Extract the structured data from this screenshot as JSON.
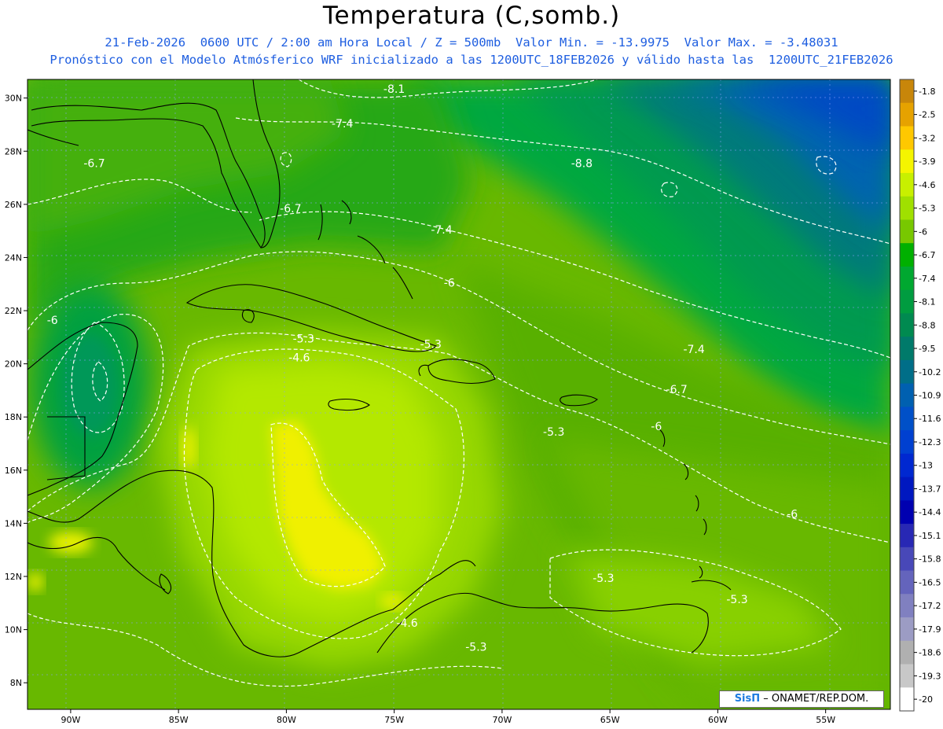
{
  "header": {
    "title": "Temperatura (C,somb.)",
    "line1": "21-Feb-2026  0600 UTC / 2:00 am Hora Local / Z = 500mb  Valor Min. = -13.9975  Valor Max. = -3.48031",
    "line2": "Pronóstico con el Modelo Atmósferico WRF inicializado a las 1200UTC_18FEB2026 y válido hasta las  1200UTC_21FEB2026"
  },
  "map": {
    "lon_range": [
      -92,
      -52
    ],
    "lat_range": [
      7,
      30.7
    ],
    "lon_ticks": [
      "90W",
      "85W",
      "80W",
      "75W",
      "70W",
      "65W",
      "60W",
      "55W"
    ],
    "lat_ticks": [
      "30N",
      "28N",
      "26N",
      "24N",
      "22N",
      "20N",
      "18N",
      "16N",
      "14N",
      "12N",
      "10N",
      "8N"
    ],
    "contour_labels": [
      {
        "text": "-8.1",
        "lon": -75.5,
        "lat": 30.2
      },
      {
        "text": "-7.4",
        "lon": -77.9,
        "lat": 28.9
      },
      {
        "text": "-6.7",
        "lon": -89.4,
        "lat": 27.4
      },
      {
        "text": "-8.8",
        "lon": -66.8,
        "lat": 27.4
      },
      {
        "text": "-6.7",
        "lon": -80.3,
        "lat": 25.7
      },
      {
        "text": "-7.4",
        "lon": -73.3,
        "lat": 24.9
      },
      {
        "text": "-6",
        "lon": -72.7,
        "lat": 22.9
      },
      {
        "text": "-6",
        "lon": -91.1,
        "lat": 21.5
      },
      {
        "text": "-5.3",
        "lon": -79.7,
        "lat": 20.8
      },
      {
        "text": "-5.3",
        "lon": -73.8,
        "lat": 20.6
      },
      {
        "text": "-4.6",
        "lon": -79.9,
        "lat": 20.1
      },
      {
        "text": "-7.4",
        "lon": -61.6,
        "lat": 20.4
      },
      {
        "text": "-6.7",
        "lon": -62.4,
        "lat": 18.9
      },
      {
        "text": "-5.3",
        "lon": -68.1,
        "lat": 17.3
      },
      {
        "text": "-6",
        "lon": -63.1,
        "lat": 17.5
      },
      {
        "text": "-6",
        "lon": -56.8,
        "lat": 14.2
      },
      {
        "text": "-5.3",
        "lon": -65.8,
        "lat": 11.8
      },
      {
        "text": "-5.3",
        "lon": -59.6,
        "lat": 11.0
      },
      {
        "text": "-4.6",
        "lon": -74.9,
        "lat": 10.1
      },
      {
        "text": "-5.3",
        "lon": -71.7,
        "lat": 9.2
      }
    ]
  },
  "colorbar": {
    "labels": [
      "-1.8",
      "-2.5",
      "-3.2",
      "-3.9",
      "-4.6",
      "-5.3",
      "-6",
      "-6.7",
      "-7.4",
      "-8.1",
      "-8.8",
      "-9.5",
      "-10.2",
      "-10.9",
      "-11.6",
      "-12.3",
      "-13",
      "-13.7",
      "-14.4",
      "-15.1",
      "-15.8",
      "-16.5",
      "-17.2",
      "-17.9",
      "-18.6",
      "-19.3",
      "-20"
    ],
    "colors": [
      "#c8860a",
      "#e6a200",
      "#ffc800",
      "#f5f500",
      "#c8f000",
      "#a0e000",
      "#78c800",
      "#00b000",
      "#00a830",
      "#009c40",
      "#008a50",
      "#007a6a",
      "#006e88",
      "#0060b0",
      "#0050c8",
      "#0040d0",
      "#0028d0",
      "#0018c0",
      "#0000b0",
      "#2828b4",
      "#4848b8",
      "#6464bc",
      "#8080c0",
      "#9c9cc4",
      "#b0b0b0",
      "#c8c8c8",
      "#ffffff"
    ]
  },
  "credit": {
    "brand": "SisΠ",
    "text": "– ONAMET/REP.DOM."
  }
}
